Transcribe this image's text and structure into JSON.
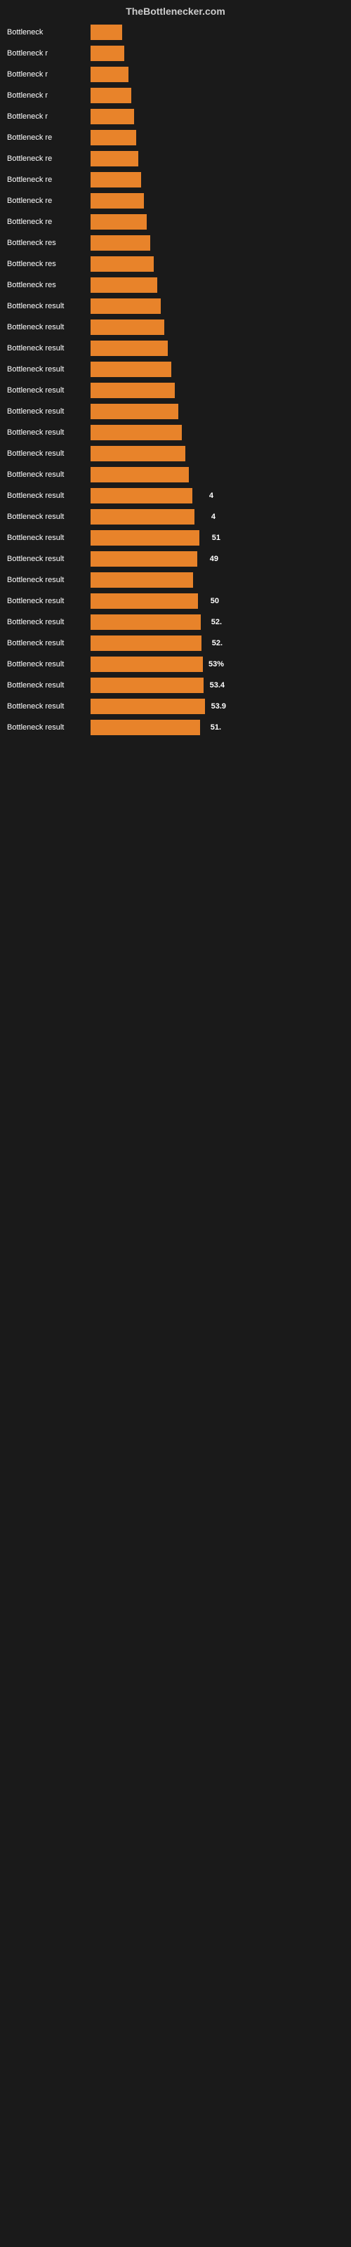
{
  "header": {
    "title": "TheBottlenecker.com"
  },
  "bars": [
    {
      "label": "Bottleneck",
      "width": 45,
      "value": ""
    },
    {
      "label": "Bottleneck r",
      "width": 48,
      "value": ""
    },
    {
      "label": "Bottleneck r",
      "width": 54,
      "value": ""
    },
    {
      "label": "Bottleneck r",
      "width": 58,
      "value": ""
    },
    {
      "label": "Bottleneck r",
      "width": 62,
      "value": ""
    },
    {
      "label": "Bottleneck re",
      "width": 65,
      "value": ""
    },
    {
      "label": "Bottleneck re",
      "width": 68,
      "value": ""
    },
    {
      "label": "Bottleneck re",
      "width": 72,
      "value": ""
    },
    {
      "label": "Bottleneck re",
      "width": 76,
      "value": ""
    },
    {
      "label": "Bottleneck re",
      "width": 80,
      "value": ""
    },
    {
      "label": "Bottleneck res",
      "width": 85,
      "value": ""
    },
    {
      "label": "Bottleneck res",
      "width": 90,
      "value": ""
    },
    {
      "label": "Bottleneck res",
      "width": 95,
      "value": ""
    },
    {
      "label": "Bottleneck result",
      "width": 100,
      "value": ""
    },
    {
      "label": "Bottleneck result",
      "width": 105,
      "value": ""
    },
    {
      "label": "Bottleneck result",
      "width": 110,
      "value": ""
    },
    {
      "label": "Bottleneck result",
      "width": 115,
      "value": ""
    },
    {
      "label": "Bottleneck result",
      "width": 120,
      "value": ""
    },
    {
      "label": "Bottleneck result",
      "width": 125,
      "value": ""
    },
    {
      "label": "Bottleneck result",
      "width": 130,
      "value": ""
    },
    {
      "label": "Bottleneck result",
      "width": 135,
      "value": ""
    },
    {
      "label": "Bottleneck result",
      "width": 140,
      "value": ""
    },
    {
      "label": "Bottleneck result",
      "width": 145,
      "value": "4"
    },
    {
      "label": "Bottleneck result",
      "width": 148,
      "value": "4"
    },
    {
      "label": "Bottleneck result",
      "width": 155,
      "value": "51"
    },
    {
      "label": "Bottleneck result",
      "width": 152,
      "value": "49"
    },
    {
      "label": "Bottleneck result",
      "width": 146,
      "value": ""
    },
    {
      "label": "Bottleneck result",
      "width": 153,
      "value": "50"
    },
    {
      "label": "Bottleneck result",
      "width": 157,
      "value": "52."
    },
    {
      "label": "Bottleneck result",
      "width": 158,
      "value": "52."
    },
    {
      "label": "Bottleneck result",
      "width": 160,
      "value": "53%"
    },
    {
      "label": "Bottleneck result",
      "width": 161,
      "value": "53.4"
    },
    {
      "label": "Bottleneck result",
      "width": 163,
      "value": "53.9"
    },
    {
      "label": "Bottleneck result",
      "width": 156,
      "value": "51."
    }
  ]
}
